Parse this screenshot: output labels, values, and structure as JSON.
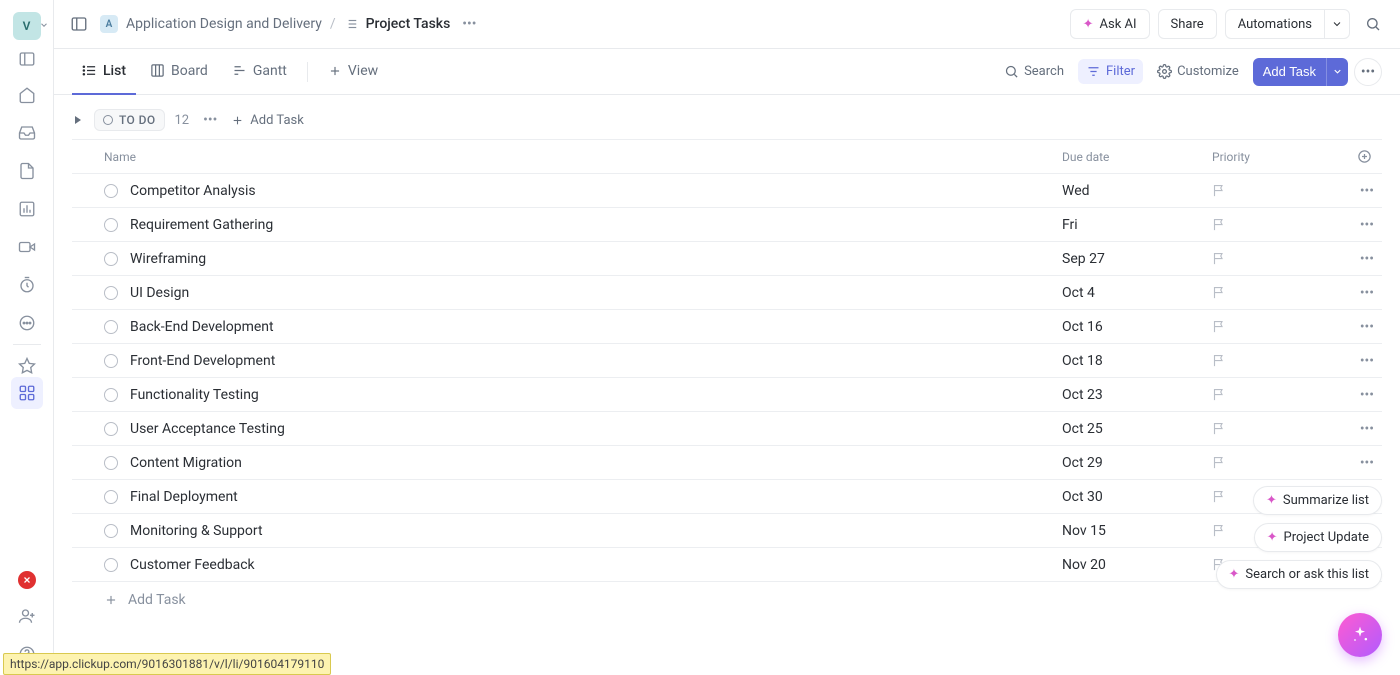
{
  "workspace_initial": "V",
  "breadcrumb": {
    "space_badge": "A",
    "space": "Application Design and Delivery",
    "list": "Project Tasks"
  },
  "topbar": {
    "ask_ai": "Ask AI",
    "share": "Share",
    "automations": "Automations"
  },
  "views": {
    "list": "List",
    "board": "Board",
    "gantt": "Gantt",
    "add_view": "View"
  },
  "tools": {
    "search": "Search",
    "filter": "Filter",
    "customize": "Customize",
    "add_task": "Add Task"
  },
  "group": {
    "status": "TO DO",
    "count": "12",
    "add_task": "Add Task"
  },
  "columns": {
    "name": "Name",
    "due": "Due date",
    "priority": "Priority"
  },
  "tasks": [
    {
      "name": "Competitor Analysis",
      "due": "Wed"
    },
    {
      "name": "Requirement Gathering",
      "due": "Fri"
    },
    {
      "name": "Wireframing",
      "due": "Sep 27"
    },
    {
      "name": "UI Design",
      "due": "Oct 4"
    },
    {
      "name": "Back-End Development",
      "due": "Oct 16"
    },
    {
      "name": "Front-End Development",
      "due": "Oct 18"
    },
    {
      "name": "Functionality Testing",
      "due": "Oct 23"
    },
    {
      "name": "User Acceptance Testing",
      "due": "Oct 25"
    },
    {
      "name": "Content Migration",
      "due": "Oct 29"
    },
    {
      "name": "Final Deployment",
      "due": "Oct 30"
    },
    {
      "name": "Monitoring & Support",
      "due": "Nov 15"
    },
    {
      "name": "Customer Feedback",
      "due": "Nov 20"
    }
  ],
  "row_add": "Add Task",
  "float": {
    "summarize": "Summarize list",
    "project_update": "Project Update",
    "search_list": "Search or ask this list"
  },
  "url_tip": "https://app.clickup.com/9016301881/v/l/li/901604179110"
}
